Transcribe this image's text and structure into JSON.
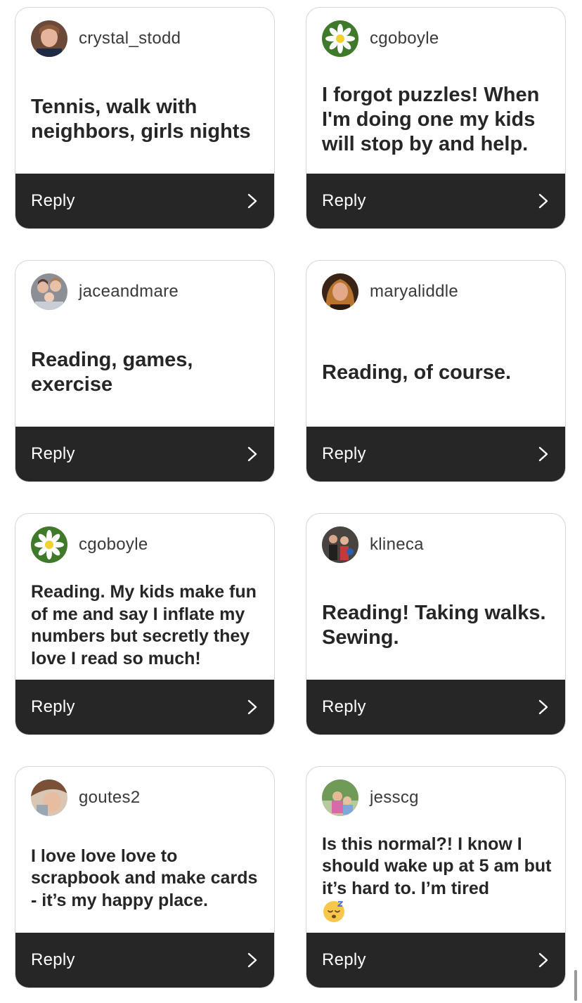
{
  "colors": {
    "card_border": "#d6d6d6",
    "reply_bar": "#262626",
    "comment_text": "#262626"
  },
  "cards": [
    {
      "username": "crystal_stodd",
      "avatar_icon": "woman-portrait-avatar",
      "comment": "Tennis, walk with neighbors, girls nights",
      "reply_label": "Reply",
      "chevron_icon": "chevron-right-icon"
    },
    {
      "username": "cgoboyle",
      "avatar_icon": "daisy-flower-avatar",
      "comment": "I forgot puzzles! When I'm doing one my kids will stop by and help.",
      "reply_label": "Reply",
      "chevron_icon": "chevron-right-icon"
    },
    {
      "username": "jaceandmare",
      "avatar_icon": "family-photo-avatar",
      "comment": "Reading, games, exercise",
      "reply_label": "Reply",
      "chevron_icon": "chevron-right-icon"
    },
    {
      "username": "maryaliddle",
      "avatar_icon": "woman-portrait-avatar",
      "comment": "Reading, of course.",
      "reply_label": "Reply",
      "chevron_icon": "chevron-right-icon"
    },
    {
      "username": "cgoboyle",
      "avatar_icon": "daisy-flower-avatar",
      "comment": "Reading. My kids make fun of me and say I inflate my numbers but secretly they love I read so much!",
      "reply_label": "Reply",
      "chevron_icon": "chevron-right-icon"
    },
    {
      "username": "klineca",
      "avatar_icon": "group-photo-avatar",
      "comment": "Reading! Taking walks. Sewing.",
      "reply_label": "Reply",
      "chevron_icon": "chevron-right-icon"
    },
    {
      "username": "goutes2",
      "avatar_icon": "person-photo-avatar",
      "comment": "I love love love to scrapbook and make cards - it’s my happy place.",
      "reply_label": "Reply",
      "chevron_icon": "chevron-right-icon"
    },
    {
      "username": "jesscg",
      "avatar_icon": "outdoor-photo-avatar",
      "comment": "Is this normal?! I know I should wake up at 5 am but it’s hard to. I’m tired",
      "emoji": "sleeping-face-emoji",
      "reply_label": "Reply",
      "chevron_icon": "chevron-right-icon"
    }
  ]
}
